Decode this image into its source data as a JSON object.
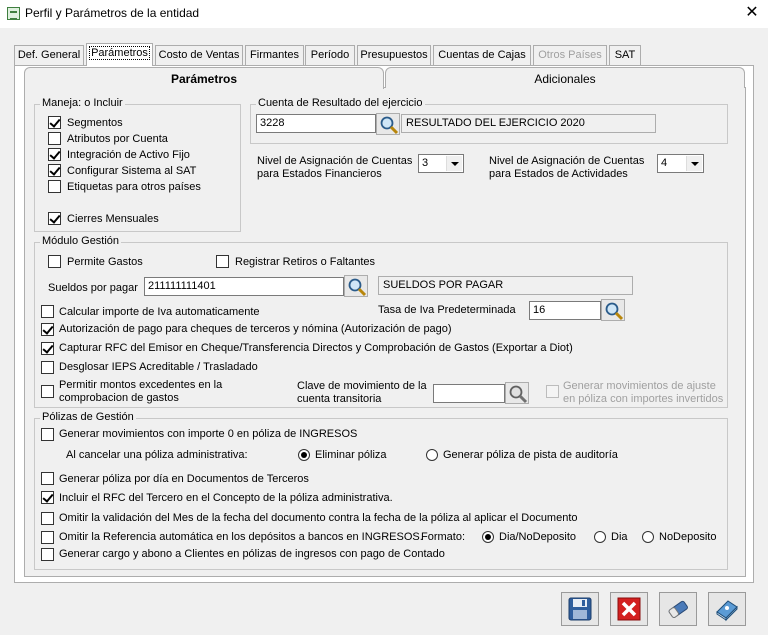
{
  "window": {
    "title": "Perfil y Parámetros de la entidad",
    "close": "✕"
  },
  "tabs": [
    "Def. General",
    "Parámetros",
    "Costo de Ventas",
    "Firmantes",
    "Período",
    "Presupuestos",
    "Cuentas de Cajas",
    "Otros Países",
    "SAT"
  ],
  "subtabs": [
    "Parámetros",
    "Adicionales"
  ],
  "maneja": {
    "legend": "Maneja: o Incluir",
    "items": [
      "Segmentos",
      "Atributos por Cuenta",
      "Integración de Activo Fijo",
      "Configurar Sistema al SAT",
      "Etiquetas para otros países",
      "Cierres Mensuales"
    ],
    "checked": [
      true,
      false,
      true,
      true,
      false,
      true
    ]
  },
  "cuenta_resultado": {
    "legend": "Cuenta de Resultado del ejercicio",
    "value": "3228",
    "description": "RESULTADO DEL EJERCICIO 2020"
  },
  "nivel_financieros": {
    "label1": "Nivel de Asignación de Cuentas",
    "label2": "para Estados Financieros",
    "value": "3"
  },
  "nivel_actividades": {
    "label1": "Nivel de Asignación de Cuentas",
    "label2": "para Estados de Actividades",
    "value": "4"
  },
  "modulo": {
    "legend": "Módulo Gestión",
    "permite_gastos": "Permite Gastos",
    "registrar_retiros": "Registrar Retiros o Faltantes",
    "sueldos_label": "Sueldos por pagar",
    "sueldos_value": "211111111401",
    "sueldos_desc": "SUELDOS POR PAGAR",
    "calcular_iva": "Calcular importe de  Iva automaticamente",
    "tasa_label": "Tasa de Iva Predeterminada",
    "tasa_value": "16",
    "autorizacion": "Autorización de pago para cheques de terceros y nómina (Autorización de pago)",
    "capturar_rfc": "Capturar RFC del Emisor en Cheque/Transferencia Directos y Comprobación de Gastos (Exportar a Diot)",
    "desglosar": "Desglosar IEPS Acreditable / Trasladado",
    "permitir1": "Permitir montos excedentes en la",
    "permitir2": "comprobacion de gastos",
    "clave1": "Clave de movimiento  de la",
    "clave2": "cuenta transitoria",
    "clave_value": "",
    "generar_ajuste1": "Generar movimientos de ajuste",
    "generar_ajuste2": "en póliza con importes invertidos"
  },
  "polizas": {
    "legend": "Pólizas de Gestión",
    "importe_cero": "Generar  movimientos con importe 0 en póliza de INGRESOS",
    "al_cancelar": "Al cancelar una póliza administrativa:",
    "eliminar": "Eliminar póliza",
    "pista": "Generar póliza de pista de auditoría",
    "por_dia": "Generar póliza por día en Documentos de Terceros",
    "incluir_rfc": "Incluir el RFC del Tercero en el Concepto de la póliza administrativa.",
    "omitir_mes": "Omitir la validación del Mes de la fecha del documento contra la fecha de la póliza  al aplicar el Documento",
    "omitir_ref": "Omitir la Referencia automática en los depósitos a bancos en INGRESOS.",
    "formato_label": "Formato:",
    "formato_opts": [
      "Dia/NoDeposito",
      "Dia",
      "NoDeposito"
    ],
    "cargo_abono": "Generar cargo y abono a  Clientes en pólizas de ingresos con pago de Contado"
  },
  "buttons": {
    "save": "save-icon",
    "cancel": "cancel-icon",
    "eraser": "eraser-icon",
    "help": "help-book-icon"
  }
}
